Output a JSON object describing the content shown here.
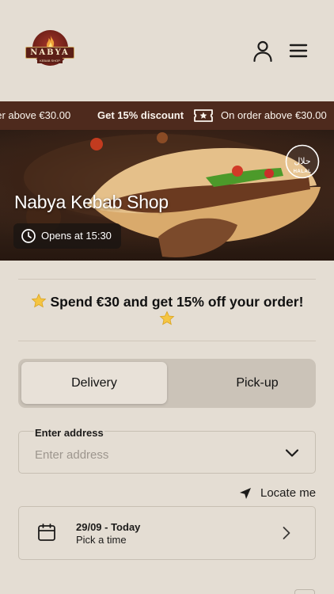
{
  "brand": {
    "name": "NABYA",
    "subtitle": "KEBAB SHOP"
  },
  "header": {
    "account_icon": "user-icon",
    "menu_icon": "hamburger-menu-icon"
  },
  "promo_ticker": {
    "left_text": "der above €30.00",
    "center_text": "Get 15% discount",
    "right_text": "On order above €30.00",
    "icon": "ticket-star-icon"
  },
  "hero": {
    "title": "Nabya Kebab Shop",
    "hours": "Opens at 15:30",
    "badge_text": "HALAL",
    "badge_script": "حلال"
  },
  "offer": {
    "text": "Spend €30 and get 15% off your order!"
  },
  "order_mode": {
    "tabs": [
      {
        "label": "Delivery",
        "active": true
      },
      {
        "label": "Pick-up",
        "active": false
      }
    ]
  },
  "address": {
    "label": "Enter address",
    "placeholder": "Enter address"
  },
  "locate": {
    "label": "Locate me"
  },
  "schedule": {
    "date": "29/09 - Today",
    "hint": "Pick a time"
  },
  "colors": {
    "background": "#e4ddd3",
    "ribbon": "#4e2a1d",
    "accent": "#6c1e17"
  }
}
